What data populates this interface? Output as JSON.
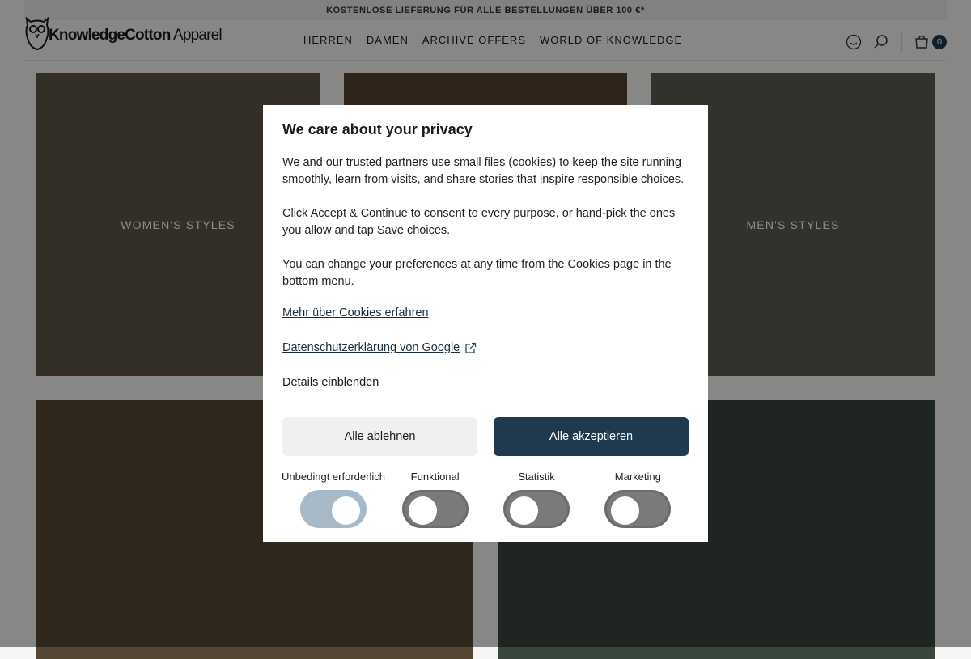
{
  "announcement": "KOSTENLOSE LIEFERUNG FÜR ALLE BESTELLUNGEN ÜBER 100 €*",
  "header": {
    "logo_bold": "KnowledgeCotton",
    "logo_light": " Apparel",
    "nav": [
      "HERREN",
      "DAMEN",
      "ARCHIVE OFFERS",
      "WORLD OF KNOWLEDGE"
    ],
    "cart_count": "0",
    "icons": [
      "account-icon",
      "search-icon",
      "cart-icon"
    ]
  },
  "tiles": {
    "women": "WOMEN'S STYLES",
    "men": "MEN'S STYLES"
  },
  "modal": {
    "title": "We care about your privacy",
    "paragraphs": [
      "We and our trusted partners use small files (cookies) to keep the site running smoothly, learn from visits, and share stories that inspire responsible choices.",
      "Click Accept & Continue to consent to every purpose, or hand-pick the ones you allow and tap Save choices.",
      "You can change your preferences at any time from the Cookies page in the bottom menu."
    ],
    "link_cookies": "Mehr über Cookies erfahren",
    "link_google": "Datenschutzerklärung von Google",
    "link_details": "Details einblenden",
    "reject_label": "Alle ablehnen",
    "accept_label": "Alle akzeptieren",
    "toggles": [
      {
        "label": "Unbedingt erforderlich",
        "on": true
      },
      {
        "label": "Funktional",
        "on": false
      },
      {
        "label": "Statistik",
        "on": false
      },
      {
        "label": "Marketing",
        "on": false
      }
    ]
  },
  "colors": {
    "accent": "#1f3a4f",
    "toggle_on": "#a7b9c6",
    "toggle_off": "#7a7a7a"
  }
}
